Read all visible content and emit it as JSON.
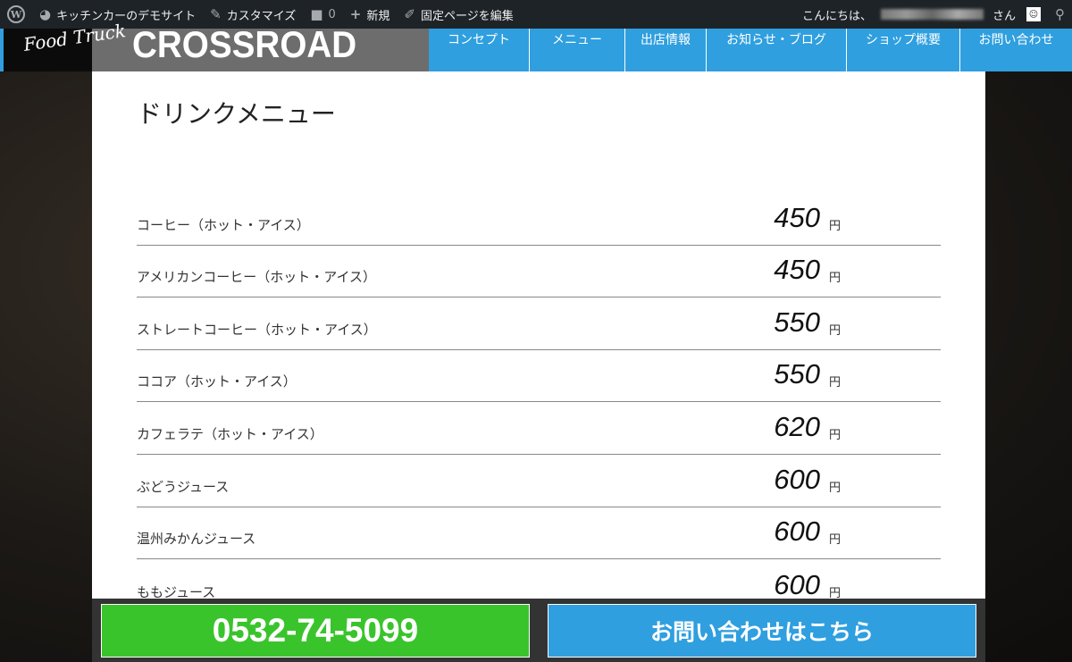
{
  "admin_bar": {
    "site_name": "キッチンカーのデモサイト",
    "customize": "カスタマイズ",
    "comments": "0",
    "new": "新規",
    "edit": "固定ページを編集",
    "greeting": "こんにちは、",
    "greeting_suffix": "さん"
  },
  "header": {
    "logo_script": "Food Truck",
    "brand": "CROSSROAD",
    "nav": [
      "コンセプト",
      "メニュー",
      "出店情報",
      "お知らせ・ブログ",
      "ショップ概要",
      "お問い合わせ"
    ]
  },
  "main": {
    "title": "ドリンクメニュー",
    "items": [
      {
        "name": "コーヒー（ホット・アイス）",
        "price": "450",
        "unit": "円"
      },
      {
        "name": "アメリカンコーヒー（ホット・アイス）",
        "price": "450",
        "unit": "円"
      },
      {
        "name": "ストレートコーヒー（ホット・アイス）",
        "price": "550",
        "unit": "円"
      },
      {
        "name": "ココア（ホット・アイス）",
        "price": "550",
        "unit": "円"
      },
      {
        "name": "カフェラテ（ホット・アイス）",
        "price": "620",
        "unit": "円"
      },
      {
        "name": "ぶどうジュース",
        "price": "600",
        "unit": "円"
      },
      {
        "name": "温州みかんジュース",
        "price": "600",
        "unit": "円"
      },
      {
        "name": "ももジュース",
        "price": "600",
        "unit": "円"
      }
    ]
  },
  "footer": {
    "phone": "0532-74-5099",
    "contact": "お問い合わせはこちら"
  },
  "colors": {
    "accent": "#2f9fdf",
    "phone_button": "#3ac42c"
  }
}
